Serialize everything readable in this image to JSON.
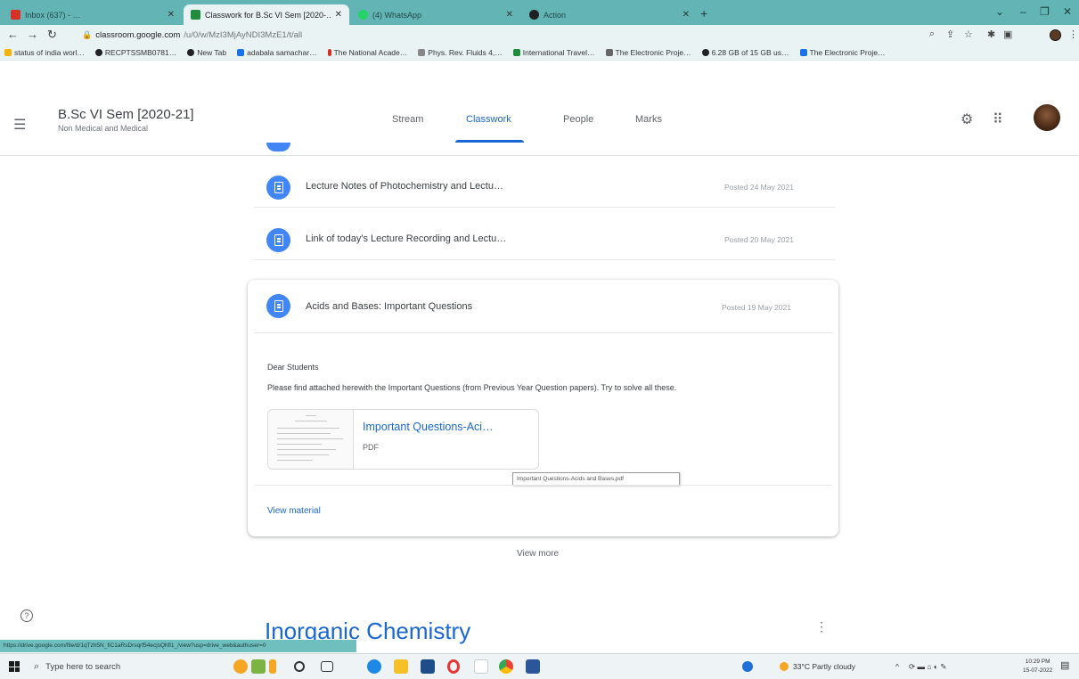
{
  "browser": {
    "tabs": [
      {
        "title": "Inbox (637) - …",
        "active": false,
        "color": "#d93025"
      },
      {
        "title": "Classwork for B.Sc VI Sem [2020-…",
        "active": true,
        "color": "#1e8e3e"
      },
      {
        "title": "(4) WhatsApp",
        "active": false,
        "color": "#25d366"
      },
      {
        "title": "Action",
        "active": false,
        "color": "#202124"
      }
    ],
    "new_tab": "+",
    "url_host": "classroom.google.com",
    "url_path": "/u/0/w/MzI3MjAyNDI3MzE1/t/all",
    "bookmarks": [
      {
        "label": "status of india worl…",
        "color": "#f4b400"
      },
      {
        "label": "RECPTSSMB0781…",
        "color": "#202124"
      },
      {
        "label": "New Tab",
        "color": "#202124"
      },
      {
        "label": "adabala samachar…",
        "color": "#1a73e8"
      },
      {
        "label": "The National Acade…",
        "color": "#d93025"
      },
      {
        "label": "Phys. Rev. Fluids 4,…",
        "color": "#888888"
      },
      {
        "label": "International Travel…",
        "color": "#1e8e3e"
      },
      {
        "label": "The Electronic Proje…",
        "color": "#666666"
      },
      {
        "label": "6.28 GB of 15 GB us…",
        "color": "#202124"
      },
      {
        "label": "The Electronic Proje…",
        "color": "#1a73e8"
      }
    ]
  },
  "classroom": {
    "class_title": "B.Sc VI Sem [2020-21]",
    "class_subtitle": "Non Medical and Medical",
    "tabs": [
      {
        "label": "Stream"
      },
      {
        "label": "Classwork"
      },
      {
        "label": "People"
      },
      {
        "label": "Marks"
      }
    ],
    "active_tab": "Classwork"
  },
  "materials": [
    {
      "title": "Lecture Notes of Photochemistry and Lectu…",
      "date": "Posted 24 May 2021"
    },
    {
      "title": "Link of today's Lecture Recording and Lectu…",
      "date": "Posted 20 May 2021"
    }
  ],
  "expanded": {
    "title": "Acids and Bases: Important Questions",
    "date": "Posted 19 May 2021",
    "greeting": "Dear Students",
    "body": "Please find attached herewith the Important Questions (from Previous Year Question papers). Try to solve all these.",
    "attachment": {
      "title": "Important Questions-Aci…",
      "type": "PDF"
    },
    "tooltip": "Important Questions-Acids and Bases.pdf",
    "view_material": "View material"
  },
  "view_more": "View more",
  "next_section": "Inorganic Chemistry",
  "status_url": "https://drive.google.com/file/d/1qTzh5N_fiC1aRsDrsqrf54ecjsQhfl1_/view?usp=drive_web&authuser=0",
  "taskbar": {
    "search_placeholder": "Type here to search",
    "weather": "33°C  Partly cloudy",
    "time": "10:29 PM",
    "date": "15-07-2022"
  }
}
